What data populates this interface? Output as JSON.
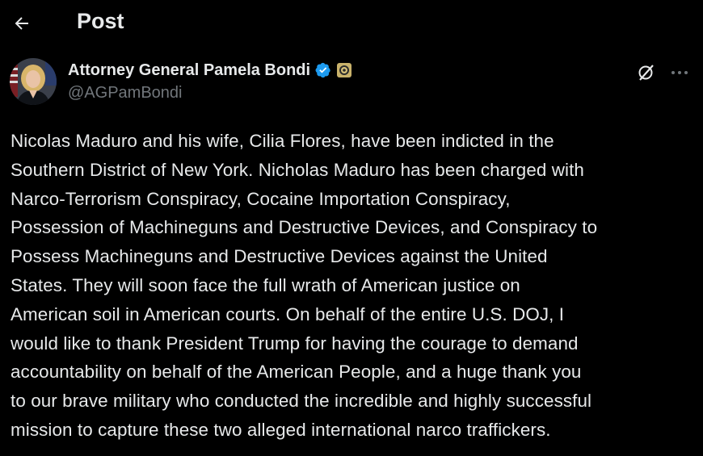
{
  "header": {
    "back_icon": "arrow-left-icon",
    "title": "Post"
  },
  "author": {
    "display_name": "Attorney General Pamela Bondi",
    "handle": "@AGPamBondi",
    "verified_badge_icon": "verified-check-icon",
    "verified_color": "#1d9bf0",
    "affiliation_badge_icon": "government-seal-icon",
    "avatar_icon": "profile-avatar"
  },
  "actions": {
    "grok_icon": "grok-icon",
    "more_icon": "more-options-icon"
  },
  "post": {
    "lines": [
      "Nicolas Maduro and his wife, Cilia Flores, have been indicted in the",
      "Southern District of New York.  Nicholas Maduro has been charged with",
      "Narco-Terrorism Conspiracy, Cocaine Importation Conspiracy,",
      "Possession of Machineguns and Destructive Devices, and Conspiracy to",
      "Possess Machineguns and Destructive Devices against the United",
      "States.  They will soon face the full wrath of American justice on",
      "American soil in American courts. On behalf of the entire U.S. DOJ, I",
      "would like to thank President Trump for having the courage to demand",
      "accountability on behalf of the American People, and a huge thank you",
      "to our brave military who conducted the incredible and highly successful",
      "mission to capture these two alleged international narco traffickers."
    ]
  },
  "colors": {
    "background": "#000000",
    "text": "#e7e9ea",
    "secondary_text": "#71767b"
  }
}
